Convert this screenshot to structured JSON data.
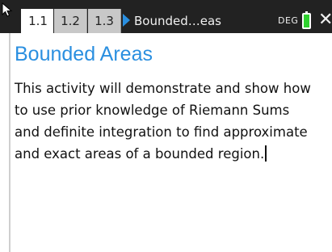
{
  "tabs": [
    {
      "label": "1.1",
      "active": true
    },
    {
      "label": "1.2",
      "active": false
    },
    {
      "label": "1.3",
      "active": false
    }
  ],
  "header": {
    "document_name": "Bounded…eas",
    "angle_mode": "DEG",
    "close_glyph": "✕"
  },
  "page": {
    "title": "Bounded Areas",
    "body_lines": [
      "This activity will demonstrate and show how",
      "to use prior knowledge of Riemann Sums",
      "and definite integration to find approximate",
      "and exact areas of a bounded region."
    ]
  },
  "colors": {
    "accent": "#2a8fe0",
    "topbar_bg": "#222222",
    "battery_fill": "#2fd02f"
  }
}
